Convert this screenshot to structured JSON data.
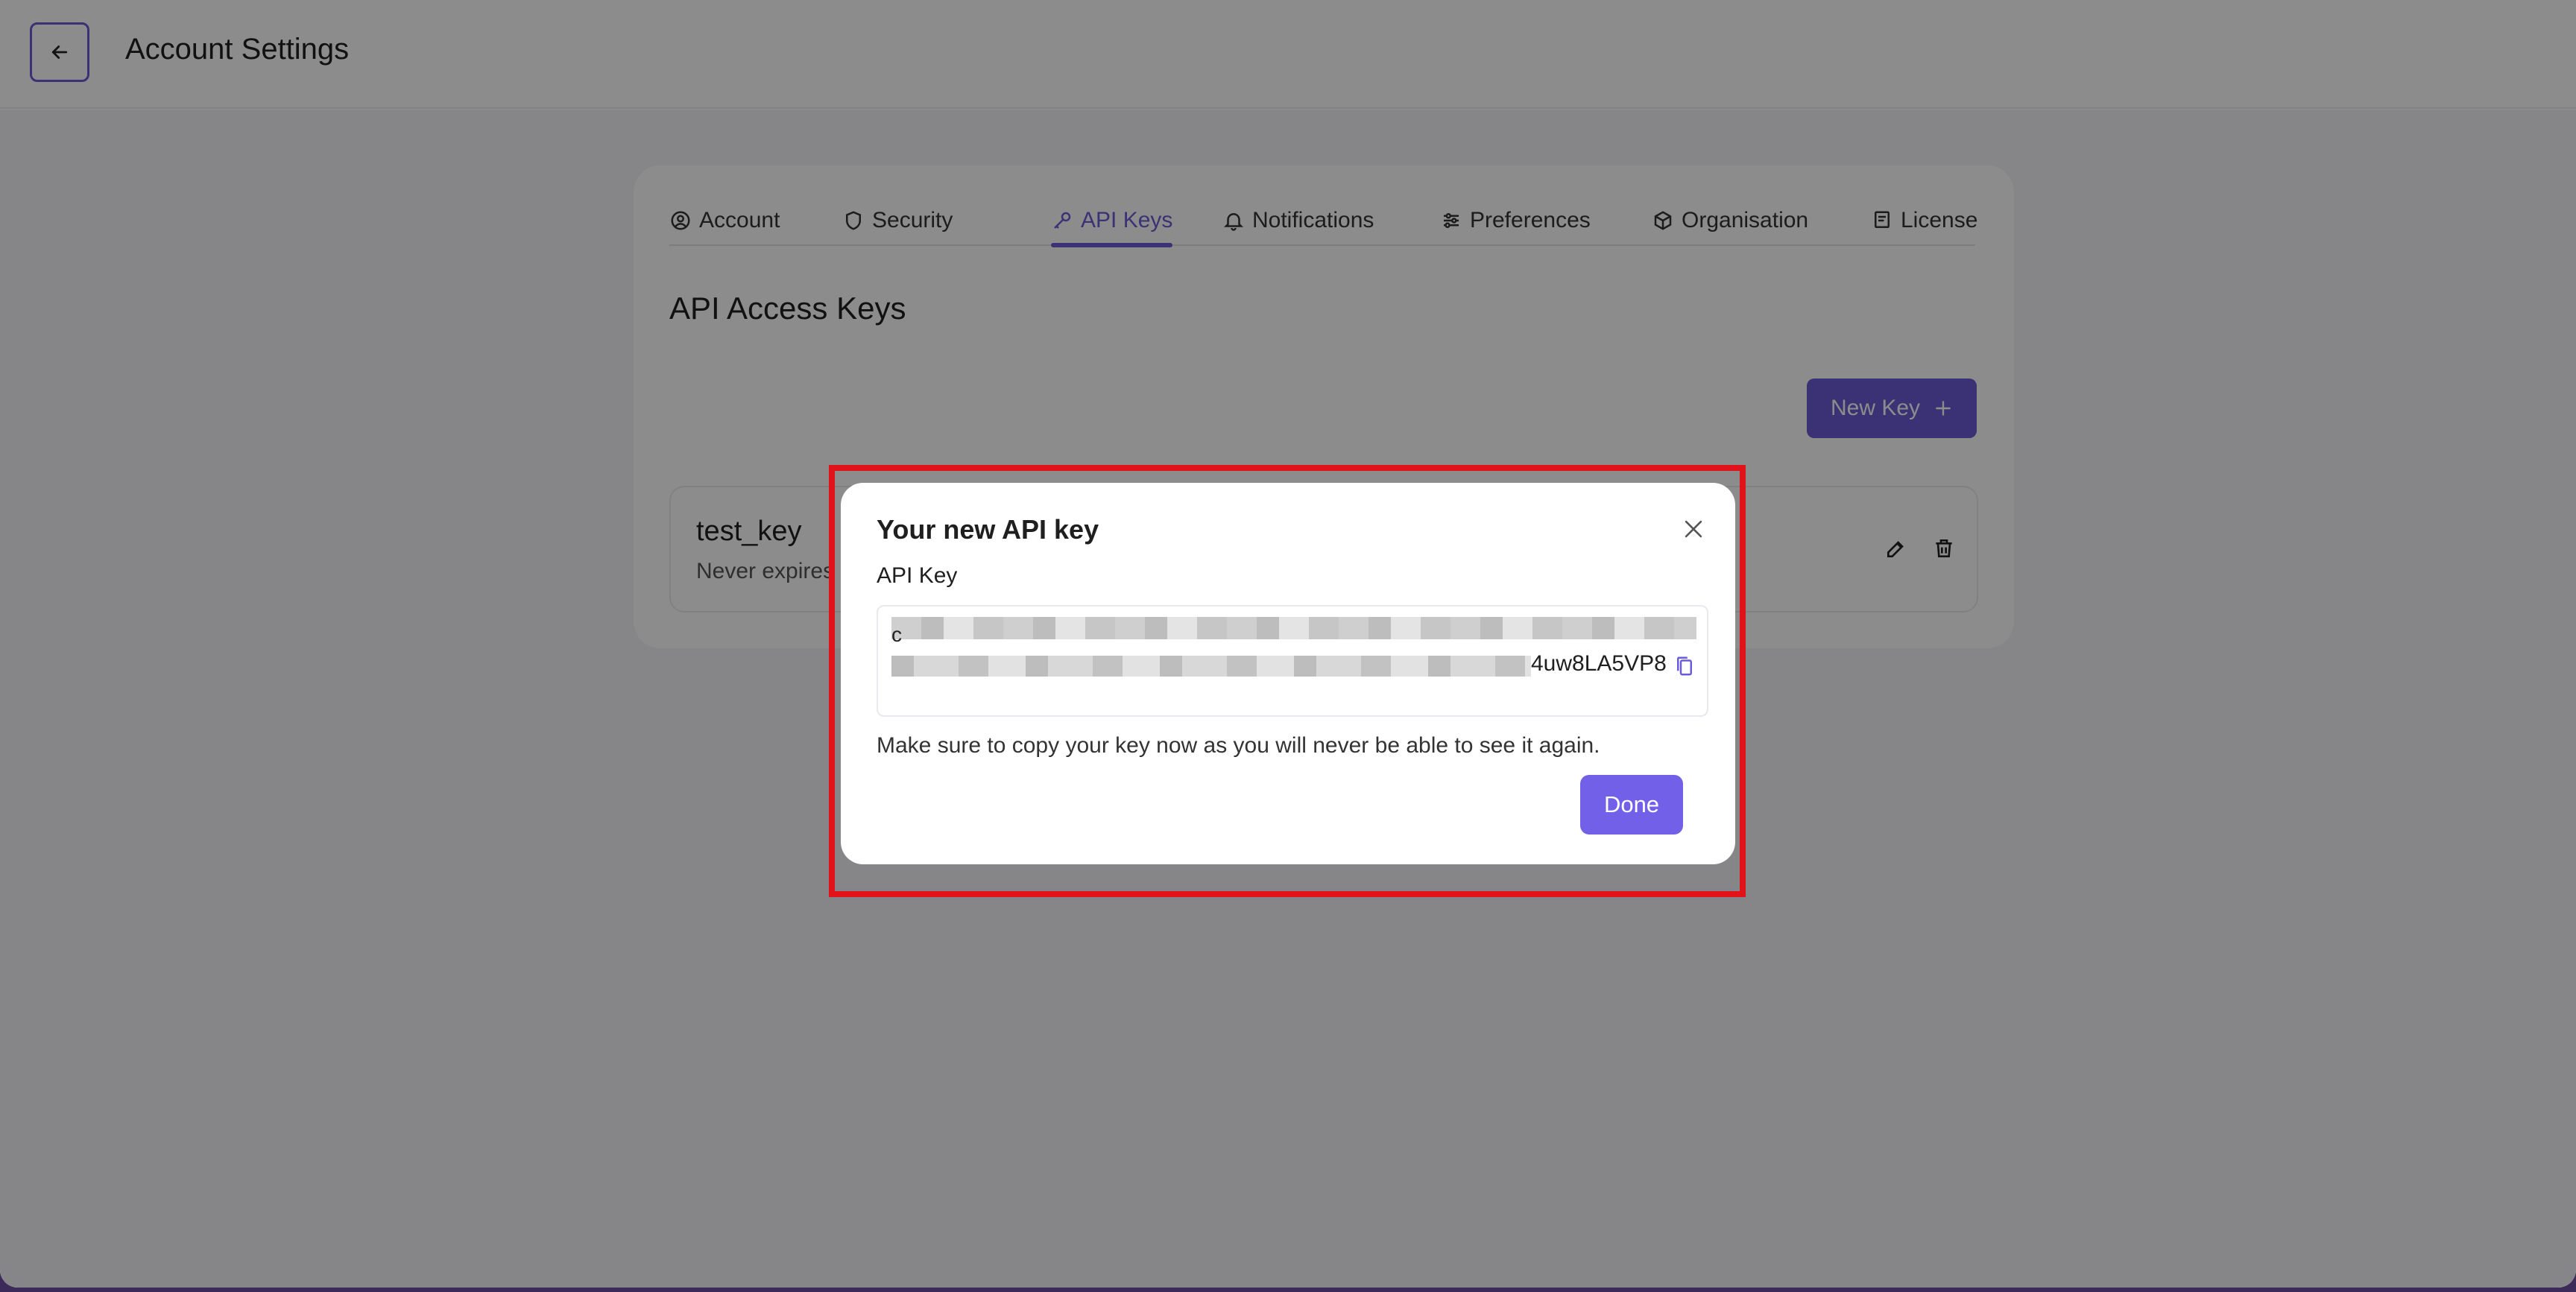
{
  "header": {
    "title": "Account Settings",
    "back_icon": "arrow-left-icon"
  },
  "tabs": [
    {
      "label": "Account",
      "icon": "user-circle-icon",
      "active": false
    },
    {
      "label": "Security",
      "icon": "shield-icon",
      "active": false
    },
    {
      "label": "API Keys",
      "icon": "key-icon",
      "active": true
    },
    {
      "label": "Notifications",
      "icon": "bell-icon",
      "active": false
    },
    {
      "label": "Preferences",
      "icon": "sliders-icon",
      "active": false
    },
    {
      "label": "Organisation",
      "icon": "cube-icon",
      "active": false
    },
    {
      "label": "License",
      "icon": "certificate-icon",
      "active": false
    }
  ],
  "section": {
    "title": "API Access Keys",
    "new_key_label": "New Key",
    "new_key_icon": "plus-icon"
  },
  "keys": [
    {
      "name": "test_key",
      "expiry": "Never expires",
      "actions": [
        "edit-icon",
        "trash-icon"
      ]
    }
  ],
  "modal": {
    "title": "Your new API key",
    "field_label": "API Key",
    "key_leading_char": "c",
    "key_visible_suffix": "4uw8LA5VP8",
    "copy_icon": "copy-icon",
    "warning": "Make sure to copy your key now as you will never be able to see it again.",
    "done_label": "Done",
    "close_icon": "close-icon"
  },
  "colors": {
    "accent": "#6b5bd6",
    "done_button": "#7360e8",
    "highlight_border": "#e2121b"
  }
}
